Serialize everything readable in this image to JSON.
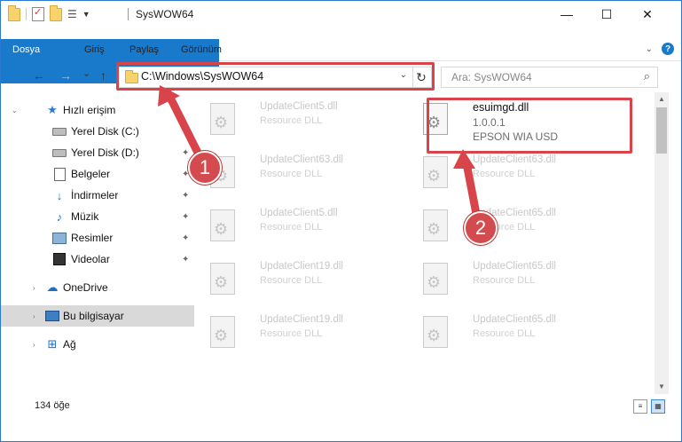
{
  "window": {
    "title": "SysWOW64",
    "minimize": "—",
    "maximize": "☐",
    "close": "✕"
  },
  "ribbon": {
    "tabs": [
      "Dosya",
      "Giriş",
      "Paylaş",
      "Görünüm"
    ],
    "expand_icon": "chevron-down-icon",
    "help_label": "?"
  },
  "nav": {
    "back": "←",
    "forward": "→",
    "recent": "⌄",
    "up": "↑",
    "address": "C:\\Windows\\SysWOW64",
    "refresh": "↻",
    "search_placeholder": "Ara: SysWOW64",
    "search_icon": "⌕"
  },
  "sidebar": {
    "items": [
      {
        "label": "Hızlı erişim",
        "icon": "star-icon"
      },
      {
        "label": "Yerel Disk (C:)",
        "icon": "drive-icon"
      },
      {
        "label": "Yerel Disk (D:)",
        "icon": "drive-icon"
      },
      {
        "label": "Belgeler",
        "icon": "documents-icon"
      },
      {
        "label": "İndirmeler",
        "icon": "download-icon"
      },
      {
        "label": "Müzik",
        "icon": "music-icon"
      },
      {
        "label": "Resimler",
        "icon": "pictures-icon"
      },
      {
        "label": "Videolar",
        "icon": "videos-icon"
      },
      {
        "label": "OneDrive",
        "icon": "cloud-icon"
      },
      {
        "label": "Bu bilgisayar",
        "icon": "computer-icon",
        "selected": true
      },
      {
        "label": "Ağ",
        "icon": "network-icon"
      }
    ]
  },
  "files": {
    "left_column": [
      {
        "name": "UpdateClient5.dll",
        "desc": "Resource DLL"
      },
      {
        "name": "UpdateClient63.dll",
        "desc": "Resource DLL"
      },
      {
        "name": "UpdateClient5.dll",
        "desc": "Resource DLL"
      },
      {
        "name": "UpdateClient19.dll",
        "desc": "Resource DLL"
      },
      {
        "name": "UpdateClient19.dll",
        "desc": "Resource DLL"
      }
    ],
    "right_column": [
      {
        "name": "esuimgd.dll",
        "version": "1.0.0.1",
        "desc": "EPSON WIA USD"
      },
      {
        "name": "UpdateClient63.dll",
        "desc": "Resource DLL"
      },
      {
        "name": "UpdateClient65.dll",
        "desc": "Resource DLL"
      },
      {
        "name": "UpdateClient65.dll",
        "desc": "Resource DLL"
      },
      {
        "name": "UpdateClient65.dll",
        "desc": "Resource DLL"
      }
    ]
  },
  "status": {
    "item_count": "134 öğe"
  },
  "annotations": {
    "step1": "1",
    "step2": "2",
    "color": "#d9444a"
  }
}
